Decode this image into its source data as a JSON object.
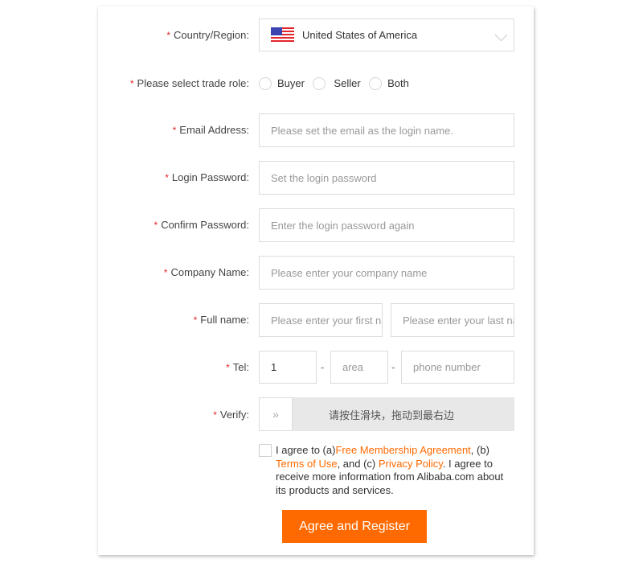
{
  "form": {
    "required_mark": "*",
    "country": {
      "label": "Country/Region:",
      "value": "United States of America",
      "flag_icon": "us-flag-icon"
    },
    "trade_role": {
      "label": "Please select trade role:",
      "options": [
        "Buyer",
        "Seller",
        "Both"
      ],
      "selected": null
    },
    "email": {
      "label": "Email Address:",
      "placeholder": "Please set the email as the login name.",
      "value": ""
    },
    "password": {
      "label": "Login Password:",
      "placeholder": "Set the login password",
      "value": ""
    },
    "confirm_password": {
      "label": "Confirm Password:",
      "placeholder": "Enter the login password again",
      "value": ""
    },
    "company": {
      "label": "Company Name:",
      "placeholder": "Please enter your company name",
      "value": ""
    },
    "full_name": {
      "label": "Full name:",
      "first_placeholder": "Please enter your first name",
      "last_placeholder": "Please enter your last name"
    },
    "tel": {
      "label": "Tel:",
      "country_code": "1",
      "area_placeholder": "area",
      "phone_placeholder": "phone number",
      "separator": "-"
    },
    "verify": {
      "label": "Verify:",
      "handle_glyph": "»",
      "instruction": "请按住滑块，拖动到最右边"
    },
    "agreement": {
      "checked": false,
      "prefix": "I agree to (a)",
      "link1": "Free Membership Agreement",
      "mid1": ", (b) ",
      "link2": "Terms of Use",
      "mid2": ", and (c) ",
      "link3": "Privacy Policy",
      "suffix": ". I agree to receive more information from Alibaba.com about its products and services."
    },
    "submit_label": "Agree and Register"
  },
  "colors": {
    "accent": "#ff6a00",
    "required": "#e4262c",
    "slider_bg": "#e8e8e8"
  }
}
